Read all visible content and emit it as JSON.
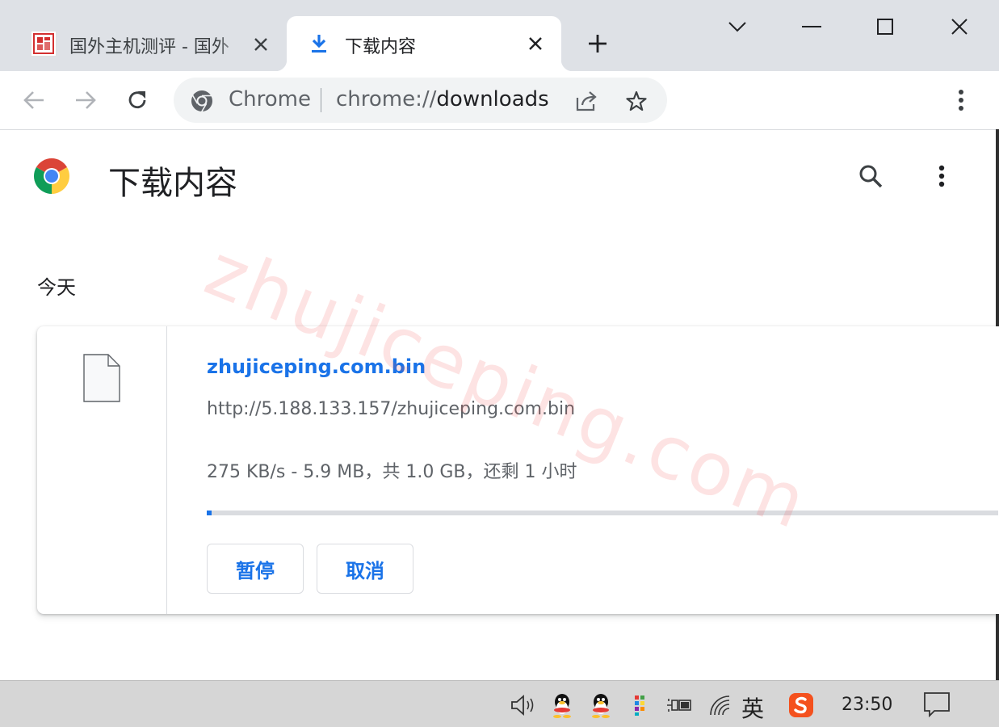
{
  "window": {
    "tabs": [
      {
        "title": "国外主机测评 - 国外",
        "active": false
      },
      {
        "title": "下载内容",
        "active": true
      }
    ]
  },
  "toolbar": {
    "omnibox_scheme": "Chrome",
    "omnibox_url_prefix": "chrome://",
    "omnibox_url_host": "downloads"
  },
  "page": {
    "title": "下载内容",
    "section_date": "今天"
  },
  "download": {
    "file_name": "zhujiceping.com.bin",
    "url": "http://5.188.133.157/zhujiceping.com.bin",
    "status": "275 KB/s - 5.9 MB，共 1.0 GB，还剩 1 小时",
    "progress_fraction": 0.006,
    "pause_label": "暂停",
    "cancel_label": "取消"
  },
  "watermark": "zhujiceping.com",
  "taskbar": {
    "ime": "英",
    "clock": "23:50"
  },
  "colors": {
    "accent": "#1a73e8",
    "tabstrip": "#dee1e6"
  }
}
